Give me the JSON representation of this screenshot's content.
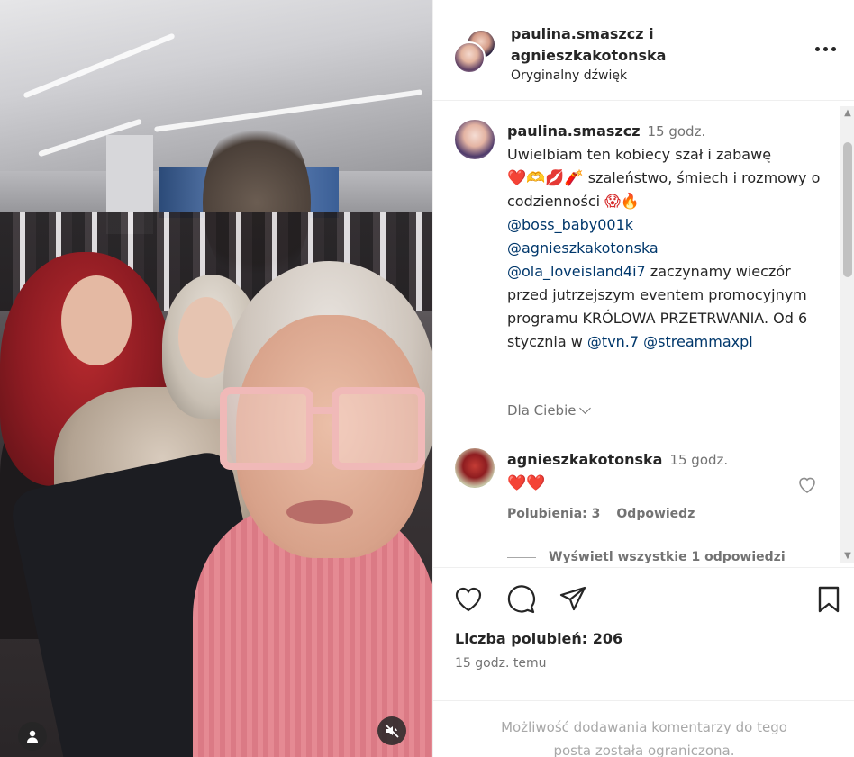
{
  "header": {
    "user_line_1": "paulina.smaszcz i",
    "user_line_2": "agnieszkakotonska",
    "audio": "Oryginalny dźwięk",
    "more_icon": "more-horizontal-icon"
  },
  "comments": [
    {
      "username": "paulina.smaszcz",
      "time": "15 godz.",
      "text_1": "Uwielbiam ten kobiecy szał i zabawę",
      "emoji_1": "❤️🫶💋🧨",
      "text_2": " szaleństwo, śmiech i rozmowy o codzienności ",
      "emoji_2": "😱🔥",
      "mention_1": "@boss_baby001k",
      "mention_2": "@agnieszkakotonska",
      "mention_3": "@ola_loveisland4i7",
      "text_3": " zaczynamy wieczór przed jutrzejszym eventem promocyjnym programu KRÓLOWA PRZETRWANIA. Od 6 stycznia w ",
      "mention_4": "@tvn.7",
      "mention_5": "@streammaxpl"
    },
    {
      "username": "agnieszkakotonska",
      "time": "15 godz.",
      "emoji": "❤️❤️",
      "likes": "Polubienia: 3",
      "reply": "Odpowiedz",
      "view_replies": "Wyświetl wszystkie 1 odpowiedzi"
    }
  ],
  "for_you": "Dla Ciebie",
  "actions": {
    "like_icon": "heart-icon",
    "comment_icon": "comment-icon",
    "share_icon": "send-icon",
    "save_icon": "bookmark-icon"
  },
  "likes": "Liczba polubień: 206",
  "post_time": "15 godz. temu",
  "footer": {
    "line_1": "Możliwość dodawania komentarzy do tego",
    "line_2": "posta została ograniczona."
  },
  "colors": {
    "text": "#262626",
    "secondary": "#737373",
    "mention": "#00376b",
    "divider": "#efefef"
  }
}
